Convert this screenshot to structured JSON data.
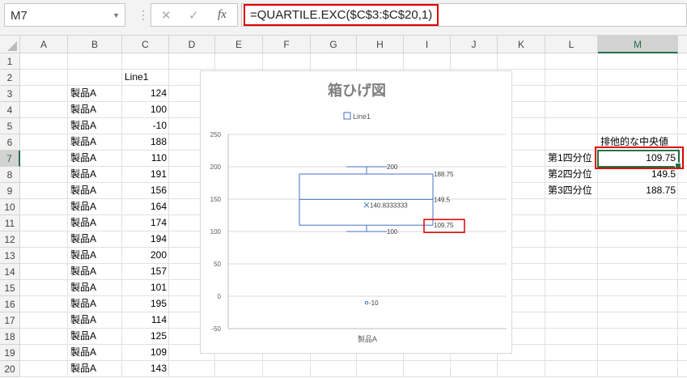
{
  "formula_bar": {
    "name_box": "M7",
    "formula": "=QUARTILE.EXC($C$3:$C$20,1)",
    "cancel_icon": "✕",
    "enter_icon": "✓",
    "fx_label": "fx"
  },
  "columns": [
    "A",
    "B",
    "C",
    "D",
    "E",
    "F",
    "G",
    "H",
    "I",
    "J",
    "K",
    "L",
    "M"
  ],
  "rows": [
    "1",
    "2",
    "3",
    "4",
    "5",
    "6",
    "7",
    "8",
    "9",
    "10",
    "11",
    "12",
    "13",
    "14",
    "15",
    "16",
    "17",
    "18",
    "19",
    "20"
  ],
  "selected": {
    "column": "M",
    "row": "7"
  },
  "data": {
    "header": "Line1",
    "labels": [
      "製品A",
      "製品A",
      "製品A",
      "製品A",
      "製品A",
      "製品A",
      "製品A",
      "製品A",
      "製品A",
      "製品A",
      "製品A",
      "製品A",
      "製品A",
      "製品A",
      "製品A",
      "製品A",
      "製品A",
      "製品A"
    ],
    "values": [
      "124",
      "100",
      "-10",
      "188",
      "110",
      "191",
      "156",
      "164",
      "174",
      "194",
      "200",
      "157",
      "101",
      "195",
      "114",
      "125",
      "109",
      "143"
    ]
  },
  "quartiles": {
    "header": "排他的な中央値",
    "labels": [
      "第1四分位",
      "第2四分位",
      "第3四分位"
    ],
    "values": [
      "109.75",
      "149.5",
      "188.75"
    ]
  },
  "chart_data": {
    "type": "boxplot",
    "title": "箱ひげ図",
    "legend": [
      "Line1"
    ],
    "legend_position": "top",
    "category": "製品A",
    "ylim": [
      -50,
      250
    ],
    "yticks": [
      "250",
      "200",
      "150",
      "100",
      "50",
      "0",
      "-50"
    ],
    "min": 100,
    "q1": 109.75,
    "median": 149.5,
    "q3": 188.75,
    "max": 200,
    "mean": 140.8333333,
    "outliers": [
      -10
    ],
    "labels": {
      "max": "200",
      "q3": "188.75",
      "median": "149.5",
      "mean": "140.8333333",
      "q1": "109.75",
      "min": "100",
      "outlier": "-10"
    },
    "color": "#4472c4"
  }
}
